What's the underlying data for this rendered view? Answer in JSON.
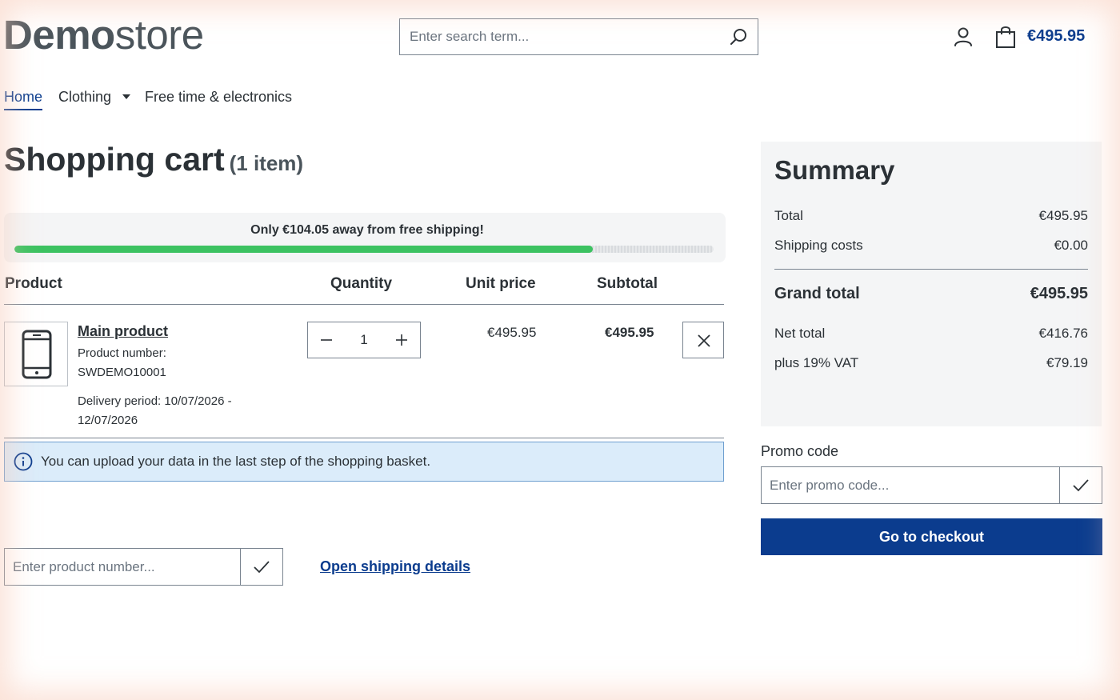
{
  "header": {
    "logo_bold": "Demo",
    "logo_light": "store",
    "search_placeholder": "Enter search term...",
    "cart_total": "€495.95",
    "icons": [
      "search-icon",
      "account-icon",
      "shopping-bag-icon"
    ]
  },
  "nav": {
    "items": [
      {
        "label": "Home",
        "active": true
      },
      {
        "label": "Clothing",
        "has_dropdown": true
      },
      {
        "label": "Free time & electronics"
      }
    ]
  },
  "cart": {
    "title": "Shopping cart",
    "count_label": "(1 item)",
    "shipping_message": "Only €104.05 away from free shipping!",
    "shipping_progress": 0.8267,
    "columns": {
      "product": "Product",
      "quantity": "Quantity",
      "unit_price": "Unit price",
      "subtotal": "Subtotal"
    },
    "items": [
      {
        "name": "Main product",
        "number_label": "Product number:",
        "number": "SWDEMO10001",
        "delivery": "Delivery period: 10/07/2026 - 12/07/2026",
        "quantity": "1",
        "unit_price": "€495.95",
        "subtotal": "€495.95",
        "image_icon": "smartphone-icon"
      }
    ],
    "info_message": "You can upload your data in the last step of the shopping basket.",
    "product_number_placeholder": "Enter product number...",
    "shipping_details_link": "Open shipping details"
  },
  "summary": {
    "title": "Summary",
    "rows": [
      {
        "label": "Total",
        "value": "€495.95"
      },
      {
        "label": "Shipping costs",
        "value": "€0.00"
      }
    ],
    "grand_total_label": "Grand total",
    "grand_total_value": "€495.95",
    "net_rows": [
      {
        "label": "Net total",
        "value": "€416.76"
      },
      {
        "label": "plus 19% VAT",
        "value": "€79.19"
      }
    ],
    "promo_label": "Promo code",
    "promo_placeholder": "Enter promo code...",
    "checkout_label": "Go to checkout"
  },
  "colors": {
    "brand": "#0b3c8e",
    "progress": "#3cc261",
    "info_bg": "#dbecfa",
    "summary_bg": "#f4f5f6"
  }
}
